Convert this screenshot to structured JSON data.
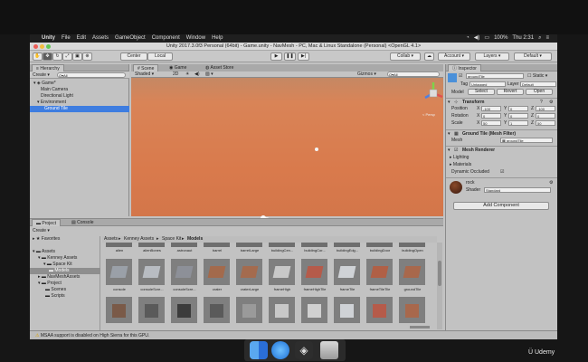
{
  "menubar": {
    "items": [
      "Unity",
      "File",
      "Edit",
      "Assets",
      "GameObject",
      "Component",
      "Window",
      "Help"
    ],
    "status_items": [
      "100%",
      "Thu 2:31"
    ]
  },
  "window": {
    "title": "Unity 2017.3.0f3 Personal (64bit) - Game.unity - NavMesh - PC, Mac & Linux Standalone (Personal) <OpenGL 4.1>"
  },
  "toolbar": {
    "center_label": "Center",
    "local_label": "Local",
    "collab_label": "Collab ▾",
    "account_label": "Account",
    "layers_label": "Layers",
    "layout_label": "Default"
  },
  "hierarchy": {
    "tab_label": "Hierarchy",
    "create_label": "Create ▾",
    "search_placeholder": "Q▾All",
    "scene_name": "Game*",
    "items": [
      "Main Camera",
      "Directional Light",
      "Environment",
      "Ground Tile"
    ]
  },
  "scene": {
    "tabs": [
      "Scene",
      "Game",
      "Asset Store"
    ],
    "shading_label": "Shaded",
    "mode_label": "2D",
    "gizmos_label": "Gizmos ▾",
    "search_placeholder": "Q▾All",
    "persp_label": "< Persp"
  },
  "inspector": {
    "tab_label": "Inspector",
    "object_name": "groundTile",
    "static_label": "Static",
    "tag_label": "Tag",
    "tag_value": "Untagged",
    "layer_label": "Layer",
    "layer_value": "Default",
    "model_label": "Model",
    "model_buttons": [
      "Select",
      "Revert",
      "Open"
    ],
    "transform": {
      "header": "Transform",
      "rows": [
        {
          "label": "Position",
          "x": "-100",
          "y": "0",
          "z": "-100"
        },
        {
          "label": "Rotation",
          "x": "0",
          "y": "0",
          "z": "0"
        },
        {
          "label": "Scale",
          "x": "50",
          "y": "1",
          "z": "50"
        }
      ]
    },
    "mesh_filter": {
      "header": "Ground Tile (Mesh Filter)",
      "mesh_label": "Mesh",
      "mesh_value": "groundTile"
    },
    "mesh_renderer": {
      "header": "Mesh Renderer",
      "lighting_label": "Lighting",
      "materials_label": "Materials",
      "dynamic_occluded_label": "Dynamic Occluded"
    },
    "material": {
      "name": "rock",
      "shader_label": "Shader",
      "shader_value": "Standard"
    },
    "add_component_label": "Add Component"
  },
  "project": {
    "tabs": [
      "Project",
      "Console"
    ],
    "create_label": "Create ▾",
    "favorites_label": "Favorites",
    "tree": [
      "Assets",
      "Kenney Assets",
      "Space Kit",
      "Models",
      "NavMeshAssets",
      "Project",
      "Scenes",
      "Scripts"
    ],
    "breadcrumb": [
      "Assets",
      "Kenney Assets",
      "Space Kit",
      "Models"
    ],
    "top_labels": [
      "alien",
      "alienBones",
      "astronaut",
      "barrel",
      "barrelLarge",
      "buildingCen...",
      "buildingCor...",
      "buildingEdg...",
      "buildingDoor",
      "buildingOpen"
    ],
    "row_labels": [
      "console",
      "consoleScre...",
      "consoleScre...",
      "crater",
      "craterLarge",
      "frameHigh",
      "frameHighTile",
      "frameTile",
      "frameTileTile",
      "groundTile"
    ]
  },
  "status": {
    "message": "MSAA support is disabled on High Sierra for this GPU."
  },
  "watermark": "Udemy",
  "colors": {
    "scene_ground": "#d97a4c",
    "selection": "#3e7de0",
    "panel": "#c2c2c2"
  }
}
